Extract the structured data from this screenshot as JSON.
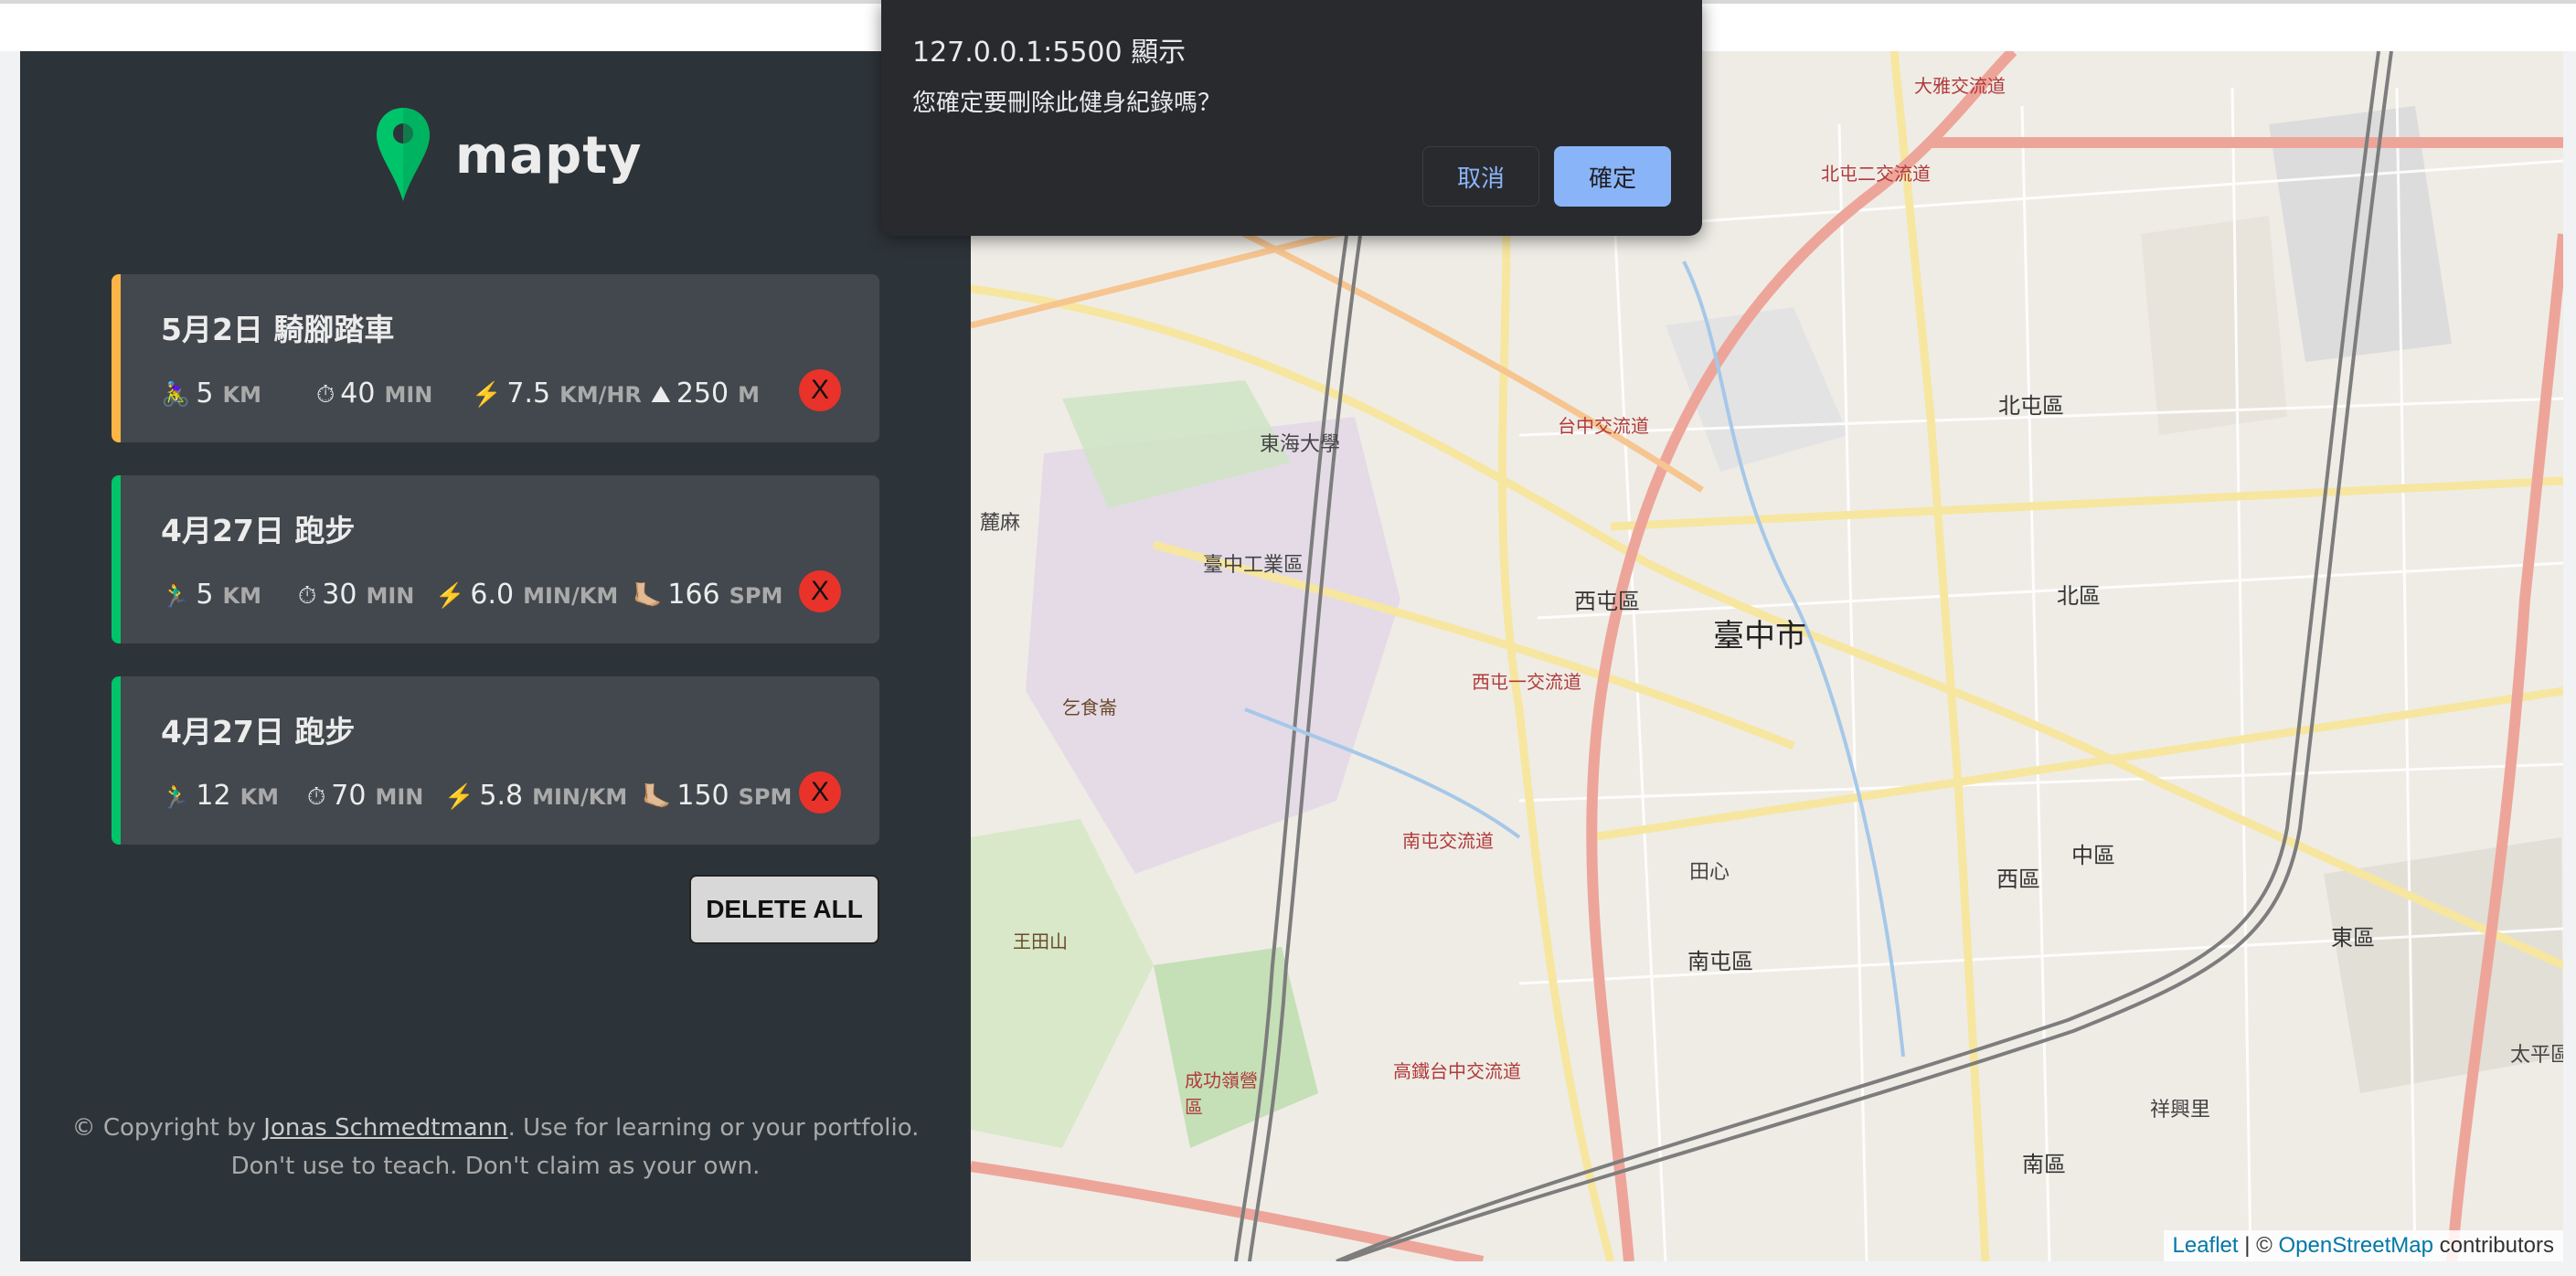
{
  "app": {
    "logo_text": "mapty"
  },
  "colors": {
    "cycling": "#ffb545",
    "running": "#00c46a",
    "sidebar_bg": "#2d3439",
    "card_bg": "#42484d",
    "delete_red": "#e8322a"
  },
  "workouts": [
    {
      "title": "5月2日 騎腳踏車",
      "type": "cycling",
      "d1_icon": "🚴‍♀️",
      "d1_val": "5",
      "d1_unit": "KM",
      "d2_icon": "⏱",
      "d2_val": "40",
      "d2_unit": "MIN",
      "d3_icon": "⚡️",
      "d3_val": "7.5",
      "d3_unit": "KM/HR",
      "d4_icon": "⛰",
      "d4_val": "250",
      "d4_unit": "M",
      "delete": "X"
    },
    {
      "title": "4月27日 跑步",
      "type": "running",
      "d1_icon": "🏃‍♂️",
      "d1_val": "5",
      "d1_unit": "KM",
      "d2_icon": "⏱",
      "d2_val": "30",
      "d2_unit": "MIN",
      "d3_icon": "⚡️",
      "d3_val": "6.0",
      "d3_unit": "MIN/KM",
      "d4_icon": "🦶🏼",
      "d4_val": "166",
      "d4_unit": "SPM",
      "delete": "X"
    },
    {
      "title": "4月27日 跑步",
      "type": "running",
      "d1_icon": "🏃‍♂️",
      "d1_val": "12",
      "d1_unit": "KM",
      "d2_icon": "⏱",
      "d2_val": "70",
      "d2_unit": "MIN",
      "d3_icon": "⚡️",
      "d3_val": "5.8",
      "d3_unit": "MIN/KM",
      "d4_icon": "🦶🏼",
      "d4_val": "150",
      "d4_unit": "SPM",
      "delete": "X"
    }
  ],
  "delete_all_label": "DELETE ALL",
  "copyright": {
    "prefix": "© Copyright by ",
    "author": "Jonas Schmedtmann",
    "suffix": ". Use for learning or your portfolio.",
    "line2": "Don't use to teach. Don't claim as your own."
  },
  "dialog": {
    "title": "127.0.0.1:5500 顯示",
    "message": "您確定要刪除此健身紀錄嗎？",
    "cancel": "取消",
    "ok": "確定"
  },
  "map": {
    "labels": {
      "city": "臺中市",
      "beitun": "北屯區",
      "xitun": "西屯區",
      "north": "北區",
      "nantun": "南屯區",
      "west": "西區",
      "central": "中區",
      "east": "東區",
      "south": "南區",
      "tunghai": "東海大學",
      "industrial": "臺中工業區",
      "beilin": "麓麻",
      "tiansin": "田心",
      "taiping": "太平區",
      "xiangxingli": "祥興里",
      "dayajct": "大雅交流道",
      "beitunjct": "北屯二交流道",
      "taichungjct": "台中交流道",
      "xitun1": "西屯一交流道",
      "nantunjct": "南屯交流道",
      "gaotie": "高鐵台中交流道",
      "chenggong": "成功嶺營區",
      "wangtianshan": "王田山",
      "yishi": "乞食崙"
    },
    "attribution": {
      "leaflet": "Leaflet",
      "sep": "| ©",
      "osm": "OpenStreetMap",
      "contrib": "contributors"
    }
  }
}
